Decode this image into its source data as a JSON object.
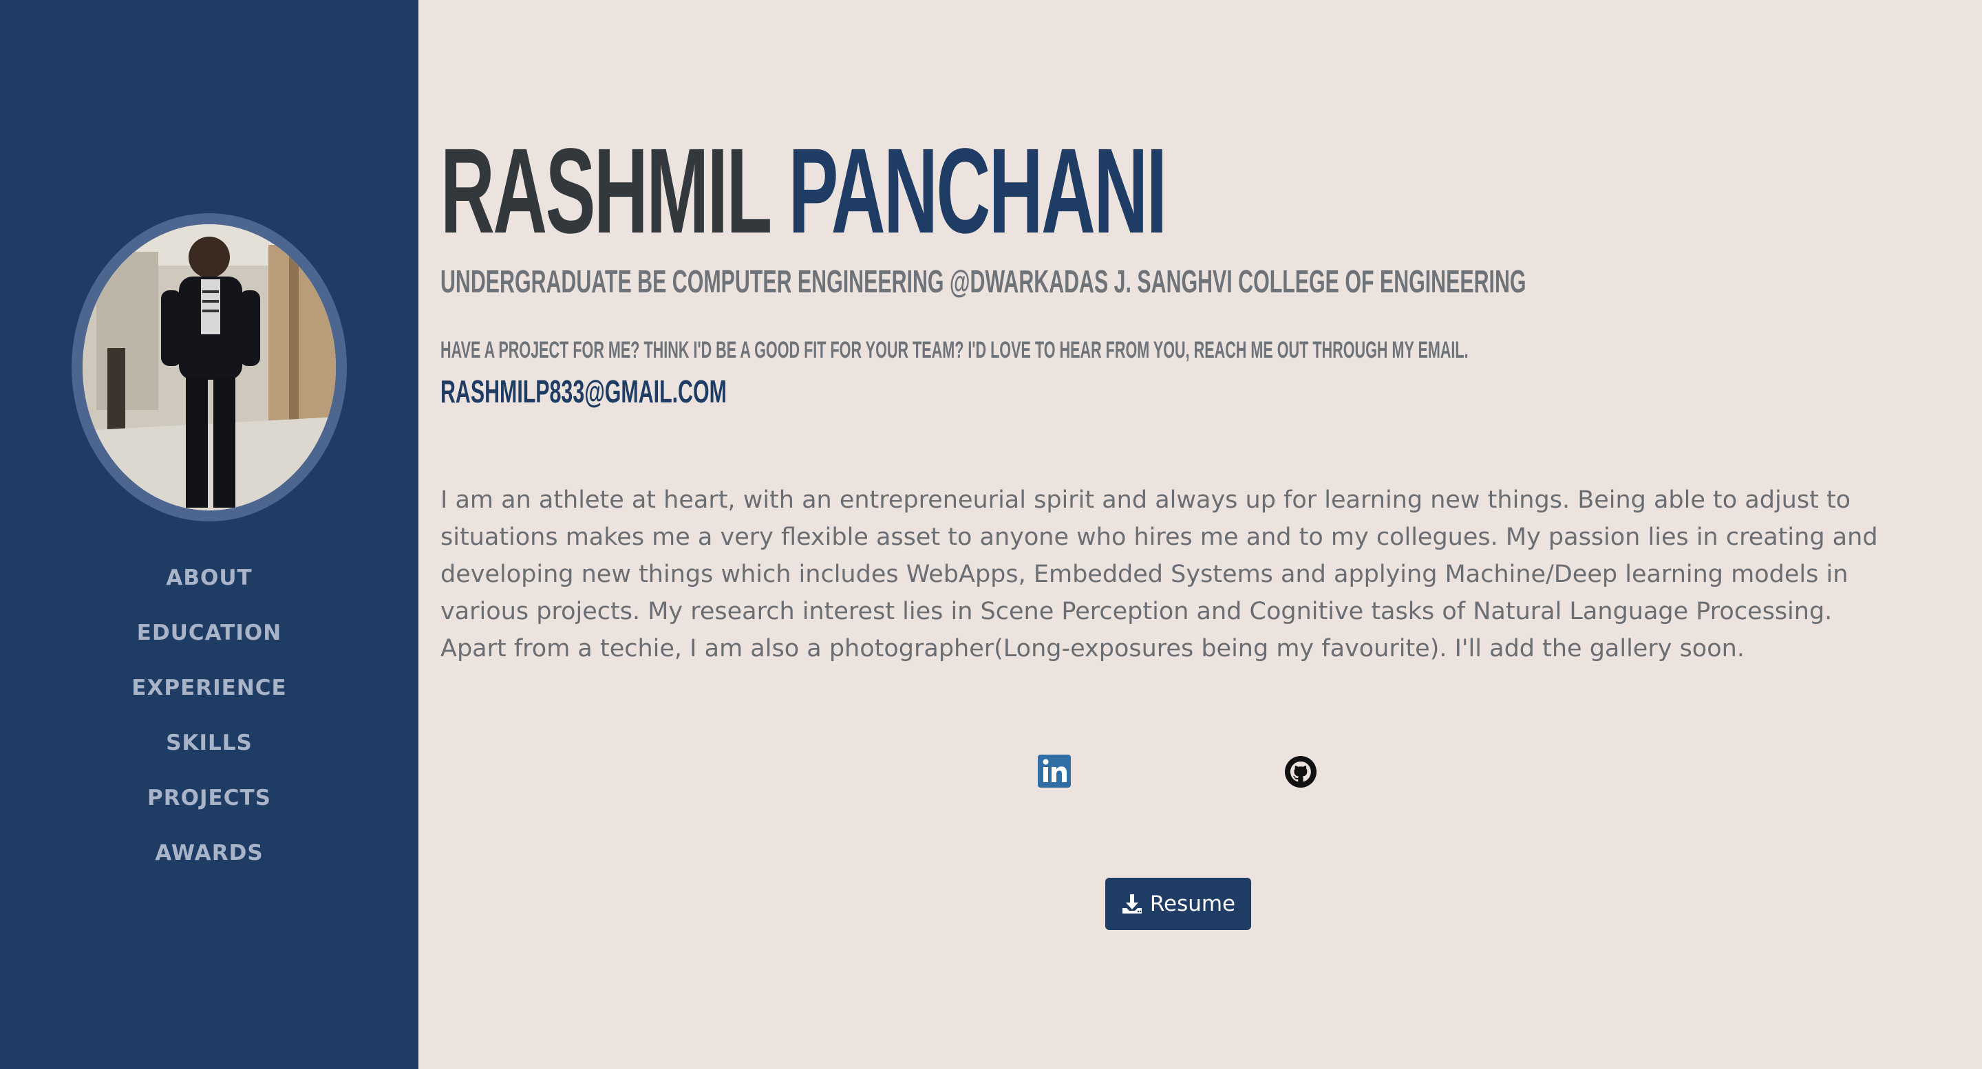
{
  "sidebar": {
    "nav": [
      {
        "label": "ABOUT"
      },
      {
        "label": "EDUCATION"
      },
      {
        "label": "EXPERIENCE"
      },
      {
        "label": "SKILLS"
      },
      {
        "label": "PROJECTS"
      },
      {
        "label": "AWARDS"
      }
    ]
  },
  "header": {
    "first_name": "RASHMIL",
    "last_name": "PANCHANI",
    "subheading": "UNDERGRADUATE BE COMPUTER ENGINEERING @DWARKADAS J. SANGHVI COLLEGE OF ENGINEERING",
    "contact_line": "HAVE A PROJECT FOR ME? THINK I'D BE A GOOD FIT FOR YOUR TEAM? I'D LOVE TO HEAR FROM YOU, REACH ME OUT THROUGH MY EMAIL.",
    "email": "RASHMILP833@GMAIL.COM"
  },
  "about": {
    "bio": "I am an athlete at heart, with an entrepreneurial spirit and always up for learning new things. Being able to adjust to situations makes me a very flexible asset to anyone who hires me and to my collegues. My passion lies in creating and developing new things which includes WebApps, Embedded Systems and applying Machine/Deep learning models in various projects. My research interest lies in Scene Perception and Cognitive tasks of Natural Language Processing. Apart from a techie, I am also a photographer(Long-exposures being my favourite). I'll add the gallery soon."
  },
  "social": {
    "linkedin_icon": "linkedin-icon",
    "github_icon": "github-icon"
  },
  "resume": {
    "label": "Resume",
    "icon": "download-icon"
  },
  "colors": {
    "sidebar_bg": "#1f3c64",
    "page_bg": "#ece3df",
    "accent": "#1f3c64",
    "linkedin": "#2f6fa5"
  }
}
